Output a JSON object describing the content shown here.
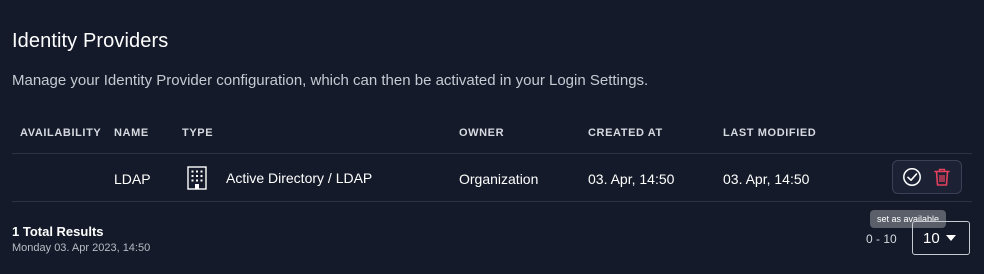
{
  "page": {
    "title": "Identity Providers",
    "description": "Manage your Identity Provider configuration, which can then be activated in your Login Settings."
  },
  "table": {
    "headers": {
      "availability": "AVAILABILITY",
      "name": "NAME",
      "type": "TYPE",
      "owner": "OWNER",
      "created_at": "CREATED AT",
      "last_modified": "LAST MODIFIED"
    },
    "rows": [
      {
        "availability": "",
        "name": "LDAP",
        "type_icon": "building-icon",
        "type": "Active Directory / LDAP",
        "owner": "Organization",
        "created_at": "03. Apr, 14:50",
        "last_modified": "03. Apr, 14:50"
      }
    ]
  },
  "actions": {
    "set_available_icon": "check-circle-icon",
    "delete_icon": "trash-icon",
    "tooltip": "set as available",
    "delete_color": "#e5405e"
  },
  "footer": {
    "total": "1 Total Results",
    "timestamp": "Monday 03. Apr 2023, 14:50",
    "range": "0 - 10",
    "page_size": "10"
  }
}
